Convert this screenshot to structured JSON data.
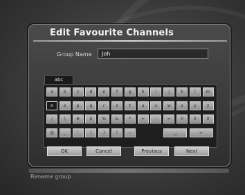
{
  "dialog": {
    "title": "Edit Favourite Channels",
    "group_label": "Group Name",
    "group_value": "Joh"
  },
  "keyboard": {
    "mode": "abc",
    "rows": [
      [
        "a",
        "b",
        "c",
        "d",
        "e",
        "f",
        "g",
        "h",
        "i",
        "j",
        "k",
        "l",
        "m"
      ],
      [
        "n",
        "o",
        "p",
        "q",
        "r",
        "s",
        "t",
        "u",
        "v",
        "w",
        "x",
        "y",
        "z"
      ],
      [
        "/",
        "\\",
        "#",
        "$",
        "%",
        "&",
        "*",
        "+",
        "-",
        "=",
        "0",
        "0",
        "0"
      ],
      [
        "@",
        "_",
        "'",
        "(",
        ")",
        "!",
        "~"
      ]
    ],
    "selected_key": "n",
    "space_glyph": "␣",
    "backspace_glyph": "←"
  },
  "buttons": {
    "ok": "OK",
    "cancel": "Cancel",
    "previous": "Previous",
    "next": "Next"
  },
  "status": {
    "text": "Rename group"
  }
}
